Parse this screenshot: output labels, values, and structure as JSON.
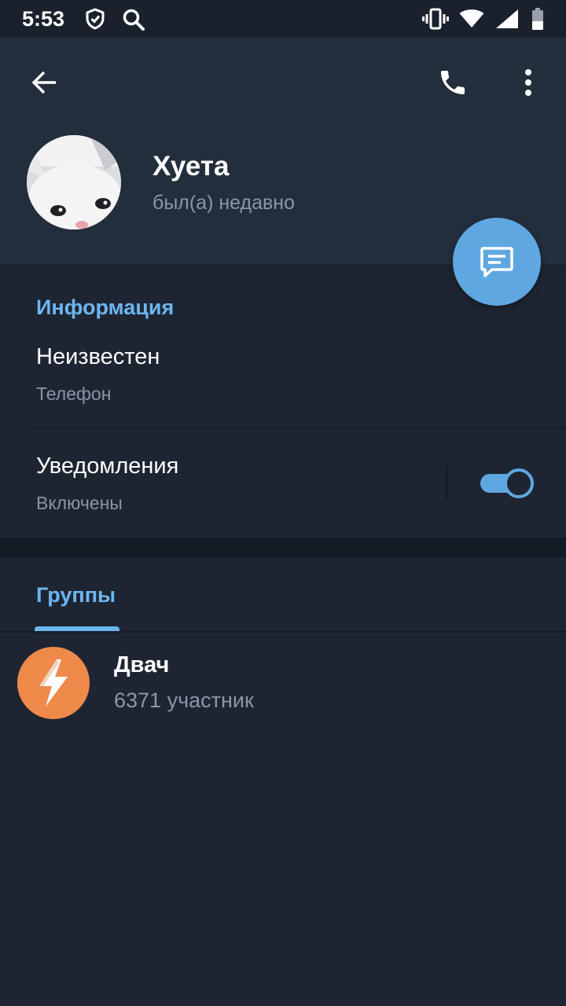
{
  "status_bar": {
    "time": "5:53",
    "left_icons": [
      "shield-icon",
      "search-icon"
    ],
    "right_icons": [
      "vibrate-icon",
      "wifi-icon",
      "signal-icon",
      "battery-icon"
    ]
  },
  "toolbar": {
    "back_icon": "arrow-left-icon",
    "call_icon": "phone-icon",
    "menu_icon": "more-vertical-icon"
  },
  "profile": {
    "name": "Хуета",
    "status": "был(а) недавно",
    "fab_icon": "message-icon"
  },
  "info_section": {
    "title": "Информация",
    "phone_value": "Неизвестен",
    "phone_label": "Телефон",
    "notifications_label": "Уведомления",
    "notifications_value": "Включены",
    "notifications_enabled": true
  },
  "tabs": [
    {
      "label": "Группы",
      "active": true
    }
  ],
  "groups": [
    {
      "name": "Двач",
      "members": "6371 участник",
      "icon": "lightning-icon"
    }
  ],
  "colors": {
    "accent": "#6cb6f0",
    "fab": "#5fa7e0",
    "group_avatar": "#ef8a4b",
    "background": "#1e2532",
    "header": "#232e3c"
  }
}
